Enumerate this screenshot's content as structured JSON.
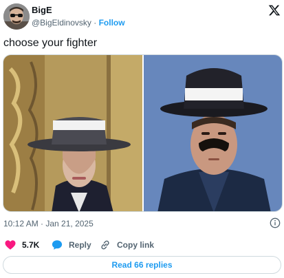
{
  "author": {
    "name": "BigE",
    "handle": "@BigEldinovsky",
    "separator": "·",
    "follow_label": "Follow"
  },
  "tweet": {
    "text": "choose your fighter",
    "timestamp": "10:12 AM · Jan 21, 2025"
  },
  "actions": {
    "like_count": "5.7K",
    "reply_label": "Reply",
    "copy_link_label": "Copy link"
  },
  "read_replies_label": "Read 66 replies",
  "colors": {
    "accent": "#1d9bf0",
    "like": "#f91880",
    "muted_text": "#536471"
  },
  "icons": [
    "x-logo-icon",
    "info-icon",
    "heart-icon",
    "reply-bubble-icon",
    "link-icon"
  ]
}
